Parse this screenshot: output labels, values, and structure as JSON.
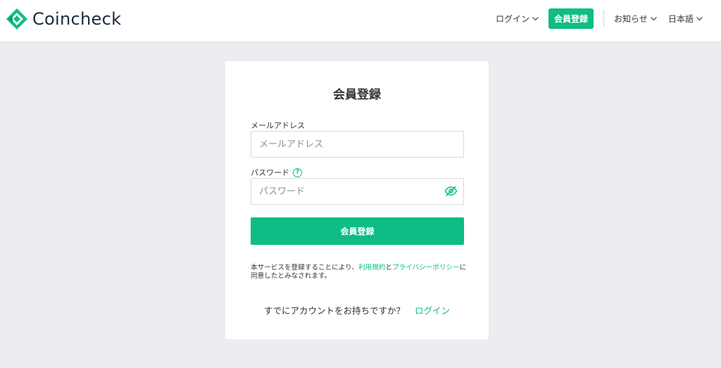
{
  "header": {
    "brand": "Coincheck",
    "nav": {
      "login": "ログイン",
      "signup": "会員登録",
      "news": "お知らせ",
      "language": "日本語"
    }
  },
  "form": {
    "title": "会員登録",
    "email": {
      "label": "メールアドレス",
      "placeholder": "メールアドレス",
      "value": ""
    },
    "password": {
      "label": "パスワード",
      "placeholder": "パスワード",
      "value": "",
      "help_glyph": "?"
    },
    "submit_label": "会員登録",
    "terms": {
      "prefix": "本サービスを登録することにより、",
      "terms_link": "利用規約",
      "conj": "と",
      "privacy_link": "プライバシーポリシー",
      "suffix": "に同意したとみなされます。"
    },
    "already": {
      "text": "すでにアカウントをお持ちですか？",
      "login_link": "ログイン"
    }
  },
  "colors": {
    "accent": "#0fbc85",
    "background": "#ecedf1",
    "text": "#2f3238"
  },
  "icons": [
    "coincheck-logo-icon",
    "chevron-down-icon",
    "help-icon",
    "eye-slash-icon"
  ]
}
